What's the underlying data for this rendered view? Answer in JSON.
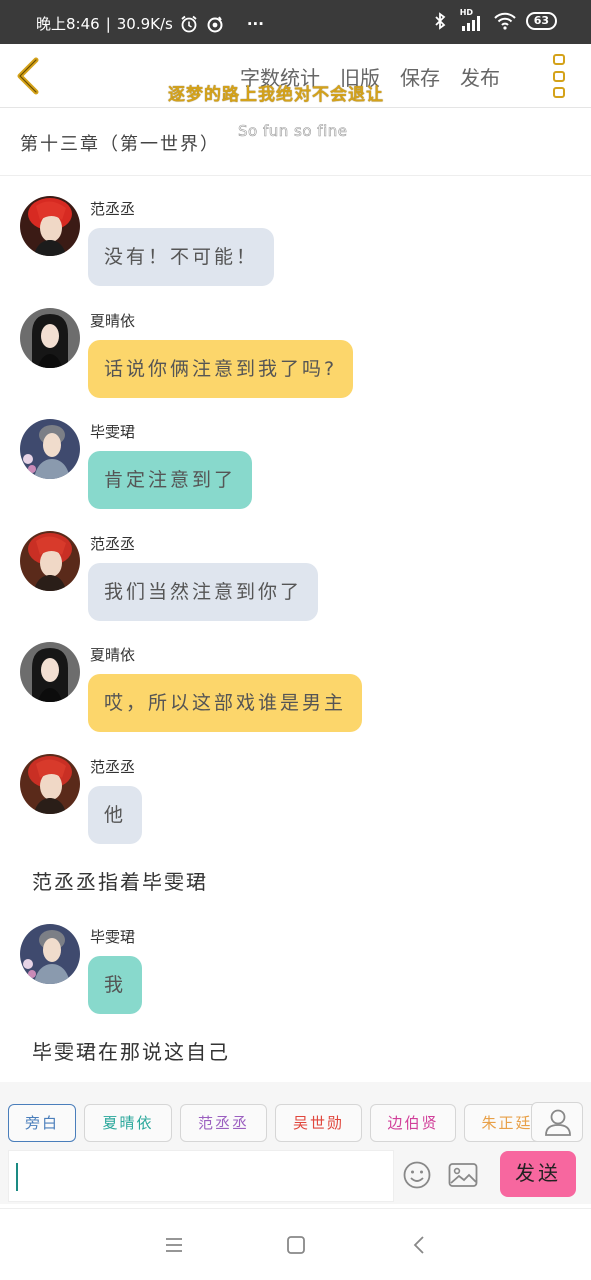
{
  "status_bar": {
    "time": "晚上8:46",
    "speed": "30.9K/s",
    "more": "···",
    "network": "HD",
    "battery": "63"
  },
  "header": {
    "actions": [
      "字数统计",
      "旧版",
      "保存",
      "发布"
    ],
    "slogan": "逐梦的路上我绝对不会退让",
    "accent_color": "#d4a21a"
  },
  "chapter": {
    "title": "第十三章（第一世界）",
    "subtitle": "So fun so fine"
  },
  "messages": [
    {
      "type": "chat",
      "name": "范丞丞",
      "text": "没有！不可能！",
      "bubble_color": "#dfe5ee",
      "avatar": "red-hair-avatar"
    },
    {
      "type": "chat",
      "name": "夏晴依",
      "text": "话说你俩注意到我了吗?",
      "bubble_color": "#fcd66b",
      "avatar": "dark-hair-avatar"
    },
    {
      "type": "chat",
      "name": "毕雯珺",
      "text": "肯定注意到了",
      "bubble_color": "#88d9cc",
      "avatar": "grey-jacket-avatar"
    },
    {
      "type": "chat",
      "name": "范丞丞",
      "text": "我们当然注意到你了",
      "bubble_color": "#dfe5ee",
      "avatar": "red-hair-avatar"
    },
    {
      "type": "chat",
      "name": "夏晴依",
      "text": "哎，所以这部戏谁是男主",
      "bubble_color": "#fcd66b",
      "avatar": "dark-hair-avatar"
    },
    {
      "type": "chat",
      "name": "范丞丞",
      "text": "他",
      "bubble_color": "#dfe5ee",
      "avatar": "red-hair-avatar"
    },
    {
      "type": "narration",
      "text": "范丞丞指着毕雯珺"
    },
    {
      "type": "chat",
      "name": "毕雯珺",
      "text": "我",
      "bubble_color": "#88d9cc",
      "avatar": "grey-jacket-avatar"
    },
    {
      "type": "narration",
      "text": "毕雯珺在那说这自己"
    }
  ],
  "chips": [
    {
      "label": "旁白",
      "color": "#4a7ebb"
    },
    {
      "label": "夏晴依",
      "color": "#2aa79b"
    },
    {
      "label": "范丞丞",
      "color": "#9b5fc0"
    },
    {
      "label": "吴世勋",
      "color": "#e0463c"
    },
    {
      "label": "边伯贤",
      "color": "#d1409a"
    },
    {
      "label": "朱正廷",
      "color": "#e8a048"
    }
  ],
  "input": {
    "value": "",
    "send_label": "发送"
  }
}
